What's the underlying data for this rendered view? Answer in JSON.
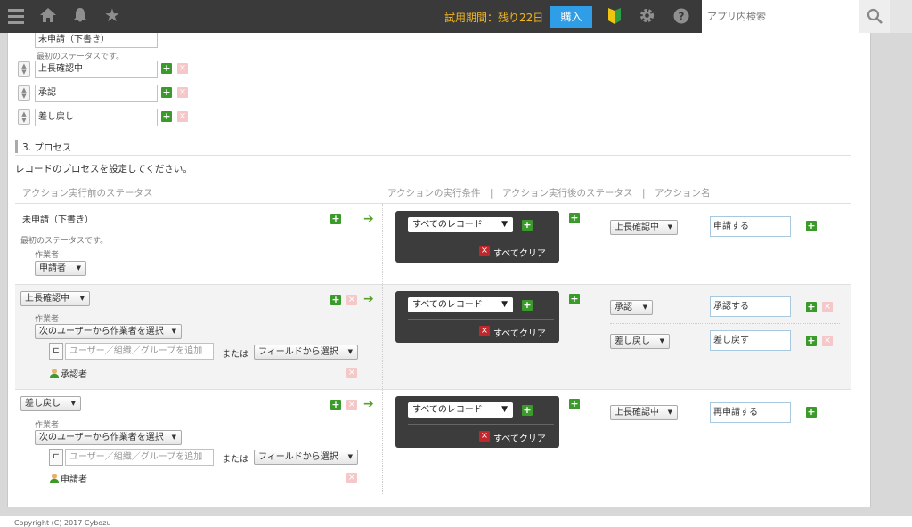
{
  "header": {
    "trial_text": "試用期間：残り22日",
    "buy_label": "購入",
    "search_placeholder": "アプリ内検索"
  },
  "statuses": {
    "first_status_value": "未申請（下書き）",
    "first_status_note": "最初のステータスです。",
    "items": [
      "上長確認中",
      "承認",
      "差し戻し"
    ]
  },
  "section": {
    "title": "3. プロセス",
    "description": "レコードのプロセスを設定してください。"
  },
  "table_header": {
    "left": "アクション実行前のステータス",
    "right": "アクションの実行条件　|　アクション実行後のステータス　|　アクション名"
  },
  "common": {
    "assignee_label": "作業者",
    "condition_all_records": "すべてのレコード",
    "clear_all": "すべてクリア",
    "user_placeholder": "ユーザー／組織／グループを追加",
    "or_text": "または",
    "field_select": "フィールドから選択",
    "assignee_mode": "次のユーザーから作業者を選択"
  },
  "process_rows": [
    {
      "status": "未申請（下書き）",
      "note": "最初のステータスです。",
      "assignee": "申請者",
      "actions": [
        {
          "next_status": "上長確認中",
          "action_name": "申請する"
        }
      ]
    },
    {
      "status": "上長確認中",
      "assignee_user": "承認者",
      "actions": [
        {
          "next_status": "承認",
          "action_name": "承認する"
        },
        {
          "next_status": "差し戻し",
          "action_name": "差し戻す"
        }
      ]
    },
    {
      "status": "差し戻し",
      "assignee_user": "申請者",
      "actions": [
        {
          "next_status": "上長確認中",
          "action_name": "再申請する"
        }
      ]
    }
  ],
  "footer": {
    "copyright": "Copyright (C) 2017 Cybozu"
  },
  "colors": {
    "header_bg": "#3a3a3a",
    "trial_text": "#f2b620",
    "buy_button": "#2f9ee6",
    "add_green": "#3a9a2a",
    "delete_red": "#c0272d"
  }
}
